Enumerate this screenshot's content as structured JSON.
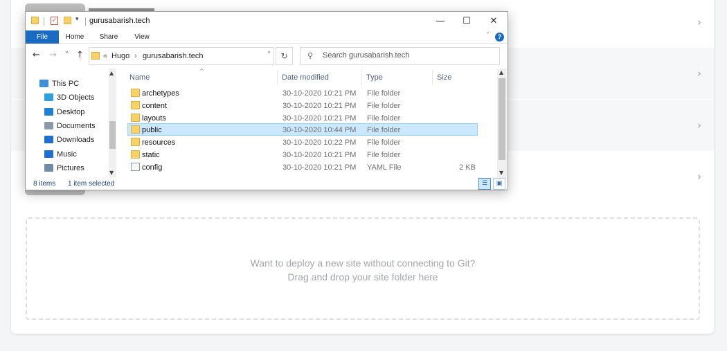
{
  "page": {
    "drop_zone": {
      "line1": "Want to deploy a new site without connecting to Git?",
      "line2": "Drag and drop your site folder here"
    },
    "row_chevron": "›"
  },
  "explorer": {
    "title": "gurusabarish.tech",
    "caption": {
      "minimize": "—",
      "maximize": "☐",
      "close": "✕"
    },
    "ribbon_tabs": [
      "File",
      "Home",
      "Share",
      "View"
    ],
    "ribbon_expand": "˅",
    "help": "?",
    "nav": {
      "back": "←",
      "forward": "→",
      "recent": "˅",
      "up": "↑"
    },
    "address": {
      "overflow": "«",
      "segments": [
        "Hugo",
        "gurusabarish.tech"
      ],
      "separator": "›",
      "dropdown": "˅"
    },
    "refresh": "↻",
    "search_placeholder": "Search gurusabarish.tech",
    "nav_pane": [
      {
        "label": "This PC",
        "icon": "pc-icon",
        "color": "#3d8fd8"
      },
      {
        "label": "3D Objects",
        "icon": "cube-icon",
        "color": "#2ea0e0"
      },
      {
        "label": "Desktop",
        "icon": "desktop-icon",
        "color": "#1e7fd6"
      },
      {
        "label": "Documents",
        "icon": "documents-icon",
        "color": "#8a9aa8"
      },
      {
        "label": "Downloads",
        "icon": "download-icon",
        "color": "#1e6fd0"
      },
      {
        "label": "Music",
        "icon": "music-icon",
        "color": "#1e6fd0"
      },
      {
        "label": "Pictures",
        "icon": "pictures-icon",
        "color": "#6f8ca8"
      }
    ],
    "columns": {
      "name": "Name",
      "date": "Date modified",
      "type": "Type",
      "size": "Size"
    },
    "files": [
      {
        "name": "archetypes",
        "date": "30-10-2020 10:21 PM",
        "type": "File folder",
        "size": "",
        "kind": "folder",
        "selected": false
      },
      {
        "name": "content",
        "date": "30-10-2020 10:21 PM",
        "type": "File folder",
        "size": "",
        "kind": "folder",
        "selected": false
      },
      {
        "name": "layouts",
        "date": "30-10-2020 10:21 PM",
        "type": "File folder",
        "size": "",
        "kind": "folder",
        "selected": false
      },
      {
        "name": "public",
        "date": "30-10-2020 10:44 PM",
        "type": "File folder",
        "size": "",
        "kind": "folder",
        "selected": true
      },
      {
        "name": "resources",
        "date": "30-10-2020 10:22 PM",
        "type": "File folder",
        "size": "",
        "kind": "folder",
        "selected": false
      },
      {
        "name": "static",
        "date": "30-10-2020 10:21 PM",
        "type": "File folder",
        "size": "",
        "kind": "folder",
        "selected": false
      },
      {
        "name": "config",
        "date": "30-10-2020 10:21 PM",
        "type": "YAML File",
        "size": "2 KB",
        "kind": "yaml",
        "selected": false
      }
    ],
    "status": {
      "count": "8 items",
      "selection": "1 item selected"
    }
  },
  "colors": {
    "accent": "#1a6cc2",
    "selection": "#cce8ff",
    "folder": "#f7d26b"
  }
}
